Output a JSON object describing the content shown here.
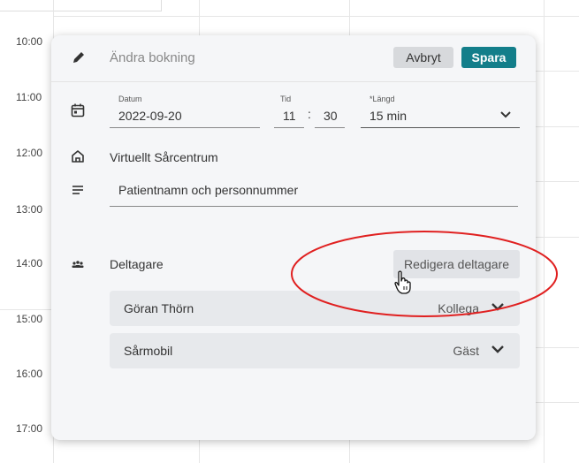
{
  "calendar": {
    "times": [
      "10:00",
      "11:00",
      "12:00",
      "13:00",
      "14:00",
      "15:00",
      "16:00",
      "17:00"
    ]
  },
  "dialog": {
    "title": "Ändra bokning",
    "cancel_label": "Avbryt",
    "save_label": "Spara",
    "date": {
      "label": "Datum",
      "value": "2022-09-20"
    },
    "time": {
      "label": "Tid",
      "hour": "11",
      "separator": ":",
      "minute": "30"
    },
    "duration": {
      "label": "*Längd",
      "value": "15 min"
    },
    "location": "Virtuellt Sårcentrum",
    "description_value": "Patientnamn och personnummer",
    "participants_label": "Deltagare",
    "edit_participants_label": "Redigera deltagare",
    "participants": [
      {
        "name": "Göran Thörn",
        "role": "Kollega"
      },
      {
        "name": "Sårmobil",
        "role": "Gäst"
      }
    ]
  },
  "colors": {
    "accent": "#137e8a",
    "annotation": "#e02020"
  },
  "icons": [
    "pencil-icon",
    "calendar-icon",
    "home-icon",
    "notes-icon",
    "people-icon",
    "chevron-down-icon",
    "hand-cursor-icon"
  ]
}
